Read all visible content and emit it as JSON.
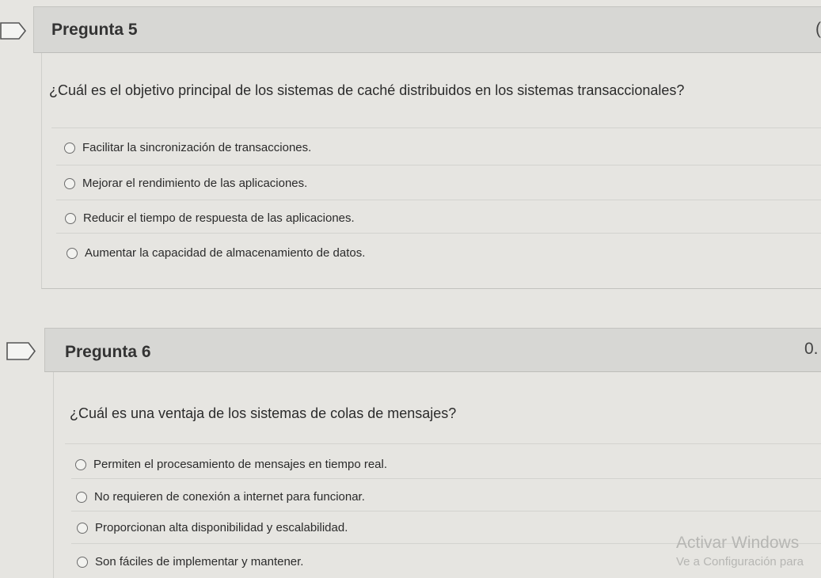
{
  "questions": [
    {
      "title": "Pregunta 5",
      "score": "(",
      "text": "¿Cuál es el objetivo principal de los sistemas de caché distribuidos en los sistemas transaccionales?",
      "options": [
        "Facilitar la sincronización de transacciones.",
        "Mejorar el rendimiento de las aplicaciones.",
        "Reducir el tiempo de respuesta de las aplicaciones.",
        "Aumentar la capacidad de almacenamiento de datos."
      ]
    },
    {
      "title": "Pregunta 6",
      "score": "0.",
      "text": "¿Cuál es una ventaja de los sistemas de colas de mensajes?",
      "options": [
        "Permiten el procesamiento de mensajes en tiempo real.",
        "No requieren de conexión a internet para funcionar.",
        "Proporcionan alta disponibilidad y escalabilidad.",
        "Son fáciles de implementar y mantener."
      ]
    }
  ],
  "watermark": {
    "line1": "Activar Windows",
    "line2": "Ve a Configuración para"
  }
}
